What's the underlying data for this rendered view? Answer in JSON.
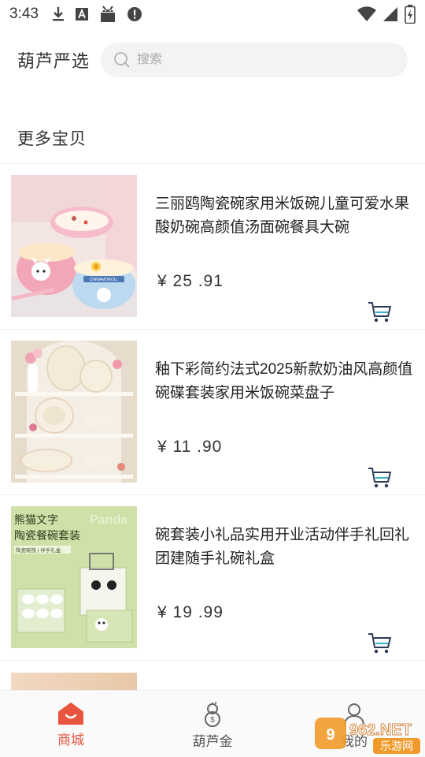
{
  "status_bar": {
    "time": "3:43",
    "left_icons": [
      "download-icon",
      "font-a-icon",
      "android-icon",
      "alert-icon"
    ],
    "right_icons": [
      "wifi-icon",
      "signal-icon",
      "battery-charging-icon"
    ]
  },
  "header": {
    "brand": "葫芦严选",
    "search_placeholder": "搜索"
  },
  "section_title": "更多宝贝",
  "products": [
    {
      "title": "三丽鸥陶瓷碗家用米饭碗儿童可爱水果酸奶碗高颜值汤面碗餐具大碗",
      "price": "¥ 25 .91",
      "image": "hello-kitty-bowls"
    },
    {
      "title": "釉下彩简约法式2025新款奶油风高颜值碗碟套装家用米饭碗菜盘子",
      "price": "¥ 11 .90",
      "image": "cream-dish-set"
    },
    {
      "title": "碗套装小礼品实用开业活动伴手礼回礼团建随手礼碗礼盒",
      "price": "¥ 19 .99",
      "image": "panda-bowl-giftbox"
    }
  ],
  "thumb_texts": {
    "panda_title_line1": "熊猫文字",
    "panda_title_line2": "陶瓷餐碗套装",
    "panda_sub": "陶瓷碗筷 | 伴手礼盒",
    "panda_bg_word": "Panda",
    "kitty_tag": "CINNAMOROLL"
  },
  "tab_bar": {
    "tabs": [
      {
        "label": "商城",
        "icon": "shop-home-icon",
        "active": true
      },
      {
        "label": "葫芦金",
        "icon": "gourd-coin-icon",
        "active": false
      },
      {
        "label": "我的",
        "icon": "profile-icon",
        "active": false
      }
    ]
  },
  "watermark": {
    "text": "962.NET",
    "sub": "乐游网"
  },
  "colors": {
    "accent": "#e9543f",
    "cart": "#2b3a55",
    "cart_accent": "#3ab0c8"
  }
}
